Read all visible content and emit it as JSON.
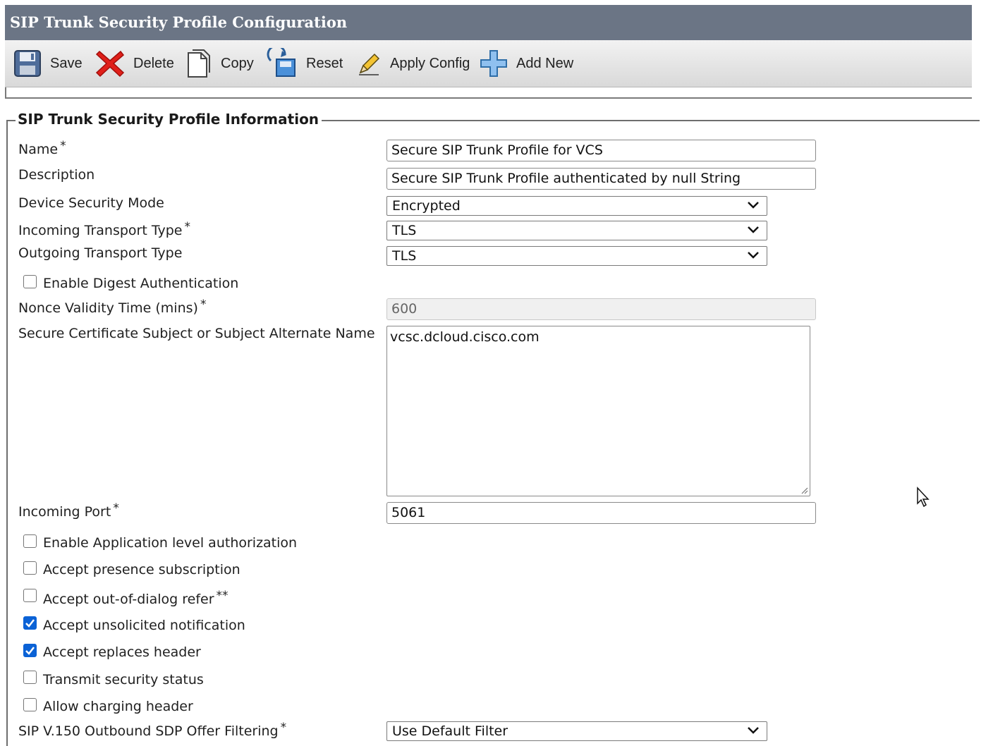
{
  "header": {
    "title": "SIP Trunk Security Profile Configuration"
  },
  "toolbar": {
    "save": "Save",
    "delete": "Delete",
    "copy": "Copy",
    "reset": "Reset",
    "apply_config": "Apply Config",
    "add_new": "Add New"
  },
  "section": {
    "title": "SIP Trunk Security Profile Information"
  },
  "fields": {
    "name": {
      "label": "Name",
      "required": "*",
      "value": "Secure SIP Trunk Profile for VCS"
    },
    "description": {
      "label": "Description",
      "value": "Secure SIP Trunk Profile authenticated by null String"
    },
    "device_security_mode": {
      "label": "Device Security Mode",
      "value": "Encrypted"
    },
    "incoming_transport": {
      "label": "Incoming Transport Type",
      "required": "*",
      "value": "TLS"
    },
    "outgoing_transport": {
      "label": "Outgoing Transport Type",
      "value": "TLS"
    },
    "digest_auth": {
      "label": "Enable Digest Authentication",
      "checked": false
    },
    "nonce_validity": {
      "label": "Nonce Validity Time (mins)",
      "required": "*",
      "value": "600"
    },
    "secure_cert": {
      "label": "Secure Certificate Subject or Subject Alternate Name",
      "value": "vcsc.dcloud.cisco.com"
    },
    "incoming_port": {
      "label": "Incoming Port",
      "required": "*",
      "value": "5061"
    },
    "app_level_auth": {
      "label": "Enable Application level authorization",
      "checked": false
    },
    "presence_sub": {
      "label": "Accept presence subscription",
      "checked": false
    },
    "out_of_dialog": {
      "label": "Accept out-of-dialog refer",
      "suffix": "**",
      "checked": false
    },
    "unsolicited": {
      "label": "Accept unsolicited notification",
      "checked": true
    },
    "replaces": {
      "label": "Accept replaces header",
      "checked": true
    },
    "transmit_sec": {
      "label": "Transmit security status",
      "checked": false
    },
    "charging": {
      "label": "Allow charging header",
      "checked": false
    },
    "sdp_filter": {
      "label": "SIP V.150 Outbound SDP Offer Filtering",
      "required": "*",
      "value": "Use Default Filter"
    }
  },
  "colors": {
    "header_bg": "#6b7585",
    "checkbox_checked": "#0b62d6",
    "delete_red": "#e0201a"
  },
  "icons": [
    "save-icon",
    "delete-icon",
    "copy-icon",
    "reset-icon",
    "apply-config-icon",
    "add-new-icon",
    "chevron-down-icon",
    "mouse-cursor-icon"
  ]
}
